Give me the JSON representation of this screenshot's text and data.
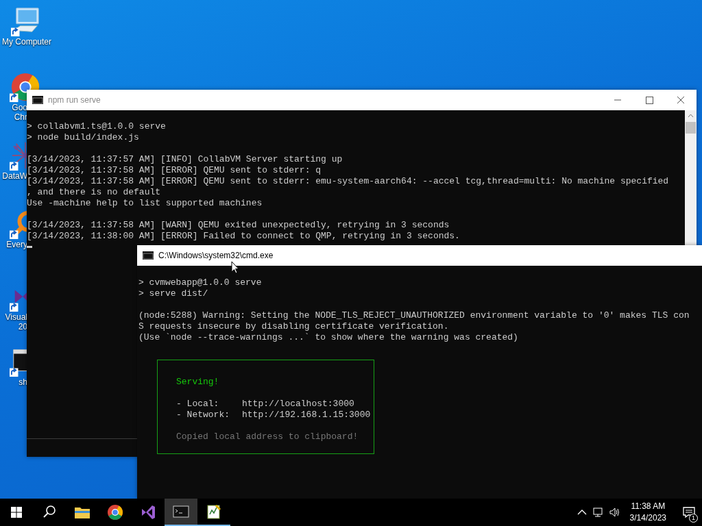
{
  "desktop_icons": [
    {
      "kind": "computer",
      "label": [
        "My Computer"
      ]
    },
    {
      "kind": "chrome",
      "label": [
        "Goo",
        "Chr"
      ]
    },
    {
      "kind": "dataw",
      "label": [
        "DataW"
      ]
    },
    {
      "kind": "everything",
      "label": [
        "Every"
      ]
    },
    {
      "kind": "vs",
      "label": [
        "Visual",
        "20"
      ]
    },
    {
      "kind": "console",
      "label": [
        "sh"
      ]
    }
  ],
  "windows": [
    {
      "title": "npm run serve",
      "active": false,
      "cursor_visible": true,
      "blocks": [
        [
          "> collabvm1.ts@1.0.0 serve",
          "> node build/index.js"
        ],
        [
          "[3/14/2023, 11:37:57 AM] [INFO] CollabVM Server starting up",
          "[3/14/2023, 11:37:58 AM] [ERROR] QEMU sent to stderr: q",
          "[3/14/2023, 11:37:58 AM] [ERROR] QEMU sent to stderr: emu-system-aarch64: --accel tcg,thread=multi: No machine specified",
          ", and there is no default",
          "Use -machine help to list supported machines"
        ],
        [
          "[3/14/2023, 11:37:58 AM] [WARN] QEMU exited unexpectedly, retrying in 3 seconds",
          "[3/14/2023, 11:38:00 AM] [ERROR] Failed to connect to QMP, retrying in 3 seconds."
        ]
      ]
    },
    {
      "title": "C:\\Windows\\system32\\cmd.exe",
      "active": true,
      "cursor_visible": false,
      "blocks": [
        [
          "> cvmwebapp@1.0.0 serve",
          "> serve dist/"
        ],
        [
          "(node:5288) Warning: Setting the NODE_TLS_REJECT_UNAUTHORIZED environment variable to '0' makes TLS con",
          "S requests insecure by disabling certificate verification.",
          "(Use `node --trace-warnings ...` to show where the warning was created)"
        ]
      ],
      "serve_box": {
        "heading": "Serving!",
        "rows": [
          {
            "label": "- Local:",
            "value": "http://localhost:3000"
          },
          {
            "label": "- Network:",
            "value": "http://192.168.1.15:3000"
          }
        ],
        "note": "Copied local address to clipboard!"
      }
    }
  ],
  "taskbar": {
    "apps": [
      {
        "kind": "explorer",
        "running": false,
        "active": false
      },
      {
        "kind": "chrome",
        "running": false,
        "active": false
      },
      {
        "kind": "vs",
        "running": false,
        "active": false
      },
      {
        "kind": "console",
        "running": true,
        "active": true
      },
      {
        "kind": "notepad",
        "running": true,
        "active": false
      }
    ],
    "time": "11:38 AM",
    "date": "3/14/2023",
    "notifications": "1"
  }
}
